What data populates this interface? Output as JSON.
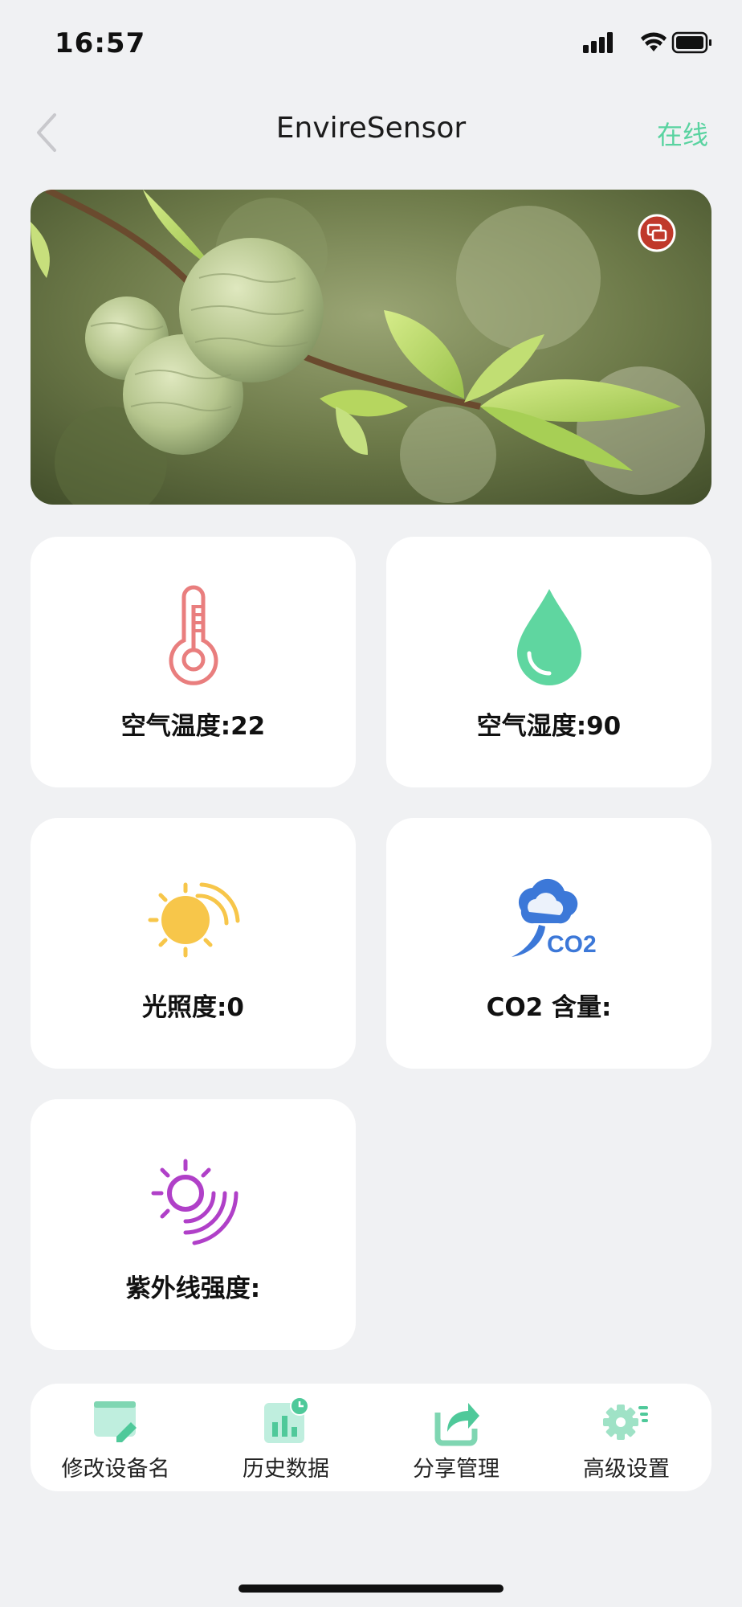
{
  "status_bar": {
    "time": "16:57"
  },
  "nav": {
    "title": "EnvireSensor",
    "status": "在线"
  },
  "sensors": [
    {
      "label": "空气温度:22",
      "icon": "thermometer-icon"
    },
    {
      "label": "空气湿度:90",
      "icon": "water-drop-icon"
    },
    {
      "label": "光照度:0",
      "icon": "sun-icon"
    },
    {
      "label": "CO2 含量:",
      "icon": "co2-cloud-icon"
    },
    {
      "label": "紫外线强度:",
      "icon": "uv-icon"
    }
  ],
  "actions": [
    {
      "label": "修改设备名",
      "icon": "edit-name-icon"
    },
    {
      "label": "历史数据",
      "icon": "history-chart-icon"
    },
    {
      "label": "分享管理",
      "icon": "share-icon"
    },
    {
      "label": "高级设置",
      "icon": "settings-icon"
    }
  ],
  "colors": {
    "accent": "#59d3a0",
    "temperature": "#e97e7e",
    "humidity": "#5fd6a0",
    "light": "#f7c64a",
    "co2": "#3c78d8",
    "uv": "#b040c8"
  }
}
